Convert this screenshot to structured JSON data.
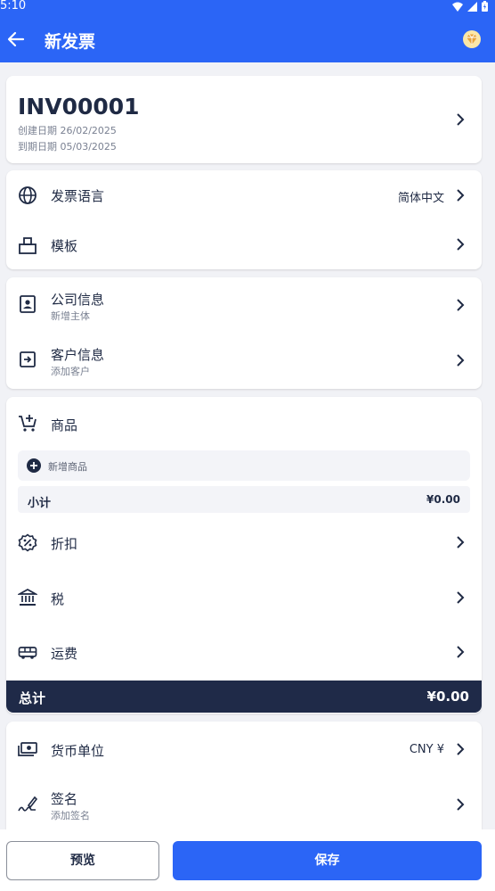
{
  "status_bar": {
    "time": "5:10"
  },
  "app_bar": {
    "title": "新发票"
  },
  "invoice": {
    "number": "INV00001",
    "created": "创建日期 26/02/2025",
    "due": "到期日期 05/03/2025"
  },
  "settings": {
    "language_label": "发票语言",
    "language_value": "简体中文",
    "template_label": "模板"
  },
  "parties": {
    "company_label": "公司信息",
    "company_sub": "新增主体",
    "client_label": "客户信息",
    "client_sub": "添加客户"
  },
  "items": {
    "title": "商品",
    "add_item": "新增商品",
    "subtotal_label": "小计",
    "subtotal_value": "¥0.00",
    "discount_label": "折扣",
    "tax_label": "税",
    "shipping_label": "运费",
    "total_label": "总计",
    "total_value": "¥0.00"
  },
  "extras": {
    "currency_label": "货币单位",
    "currency_value": "CNY ¥",
    "signature_label": "签名",
    "signature_sub": "添加签名"
  },
  "actions": {
    "preview": "预览",
    "save": "保存"
  },
  "colors": {
    "accent": "#2b65f6",
    "dark": "#1f2a48",
    "background": "#f1f2f6"
  }
}
